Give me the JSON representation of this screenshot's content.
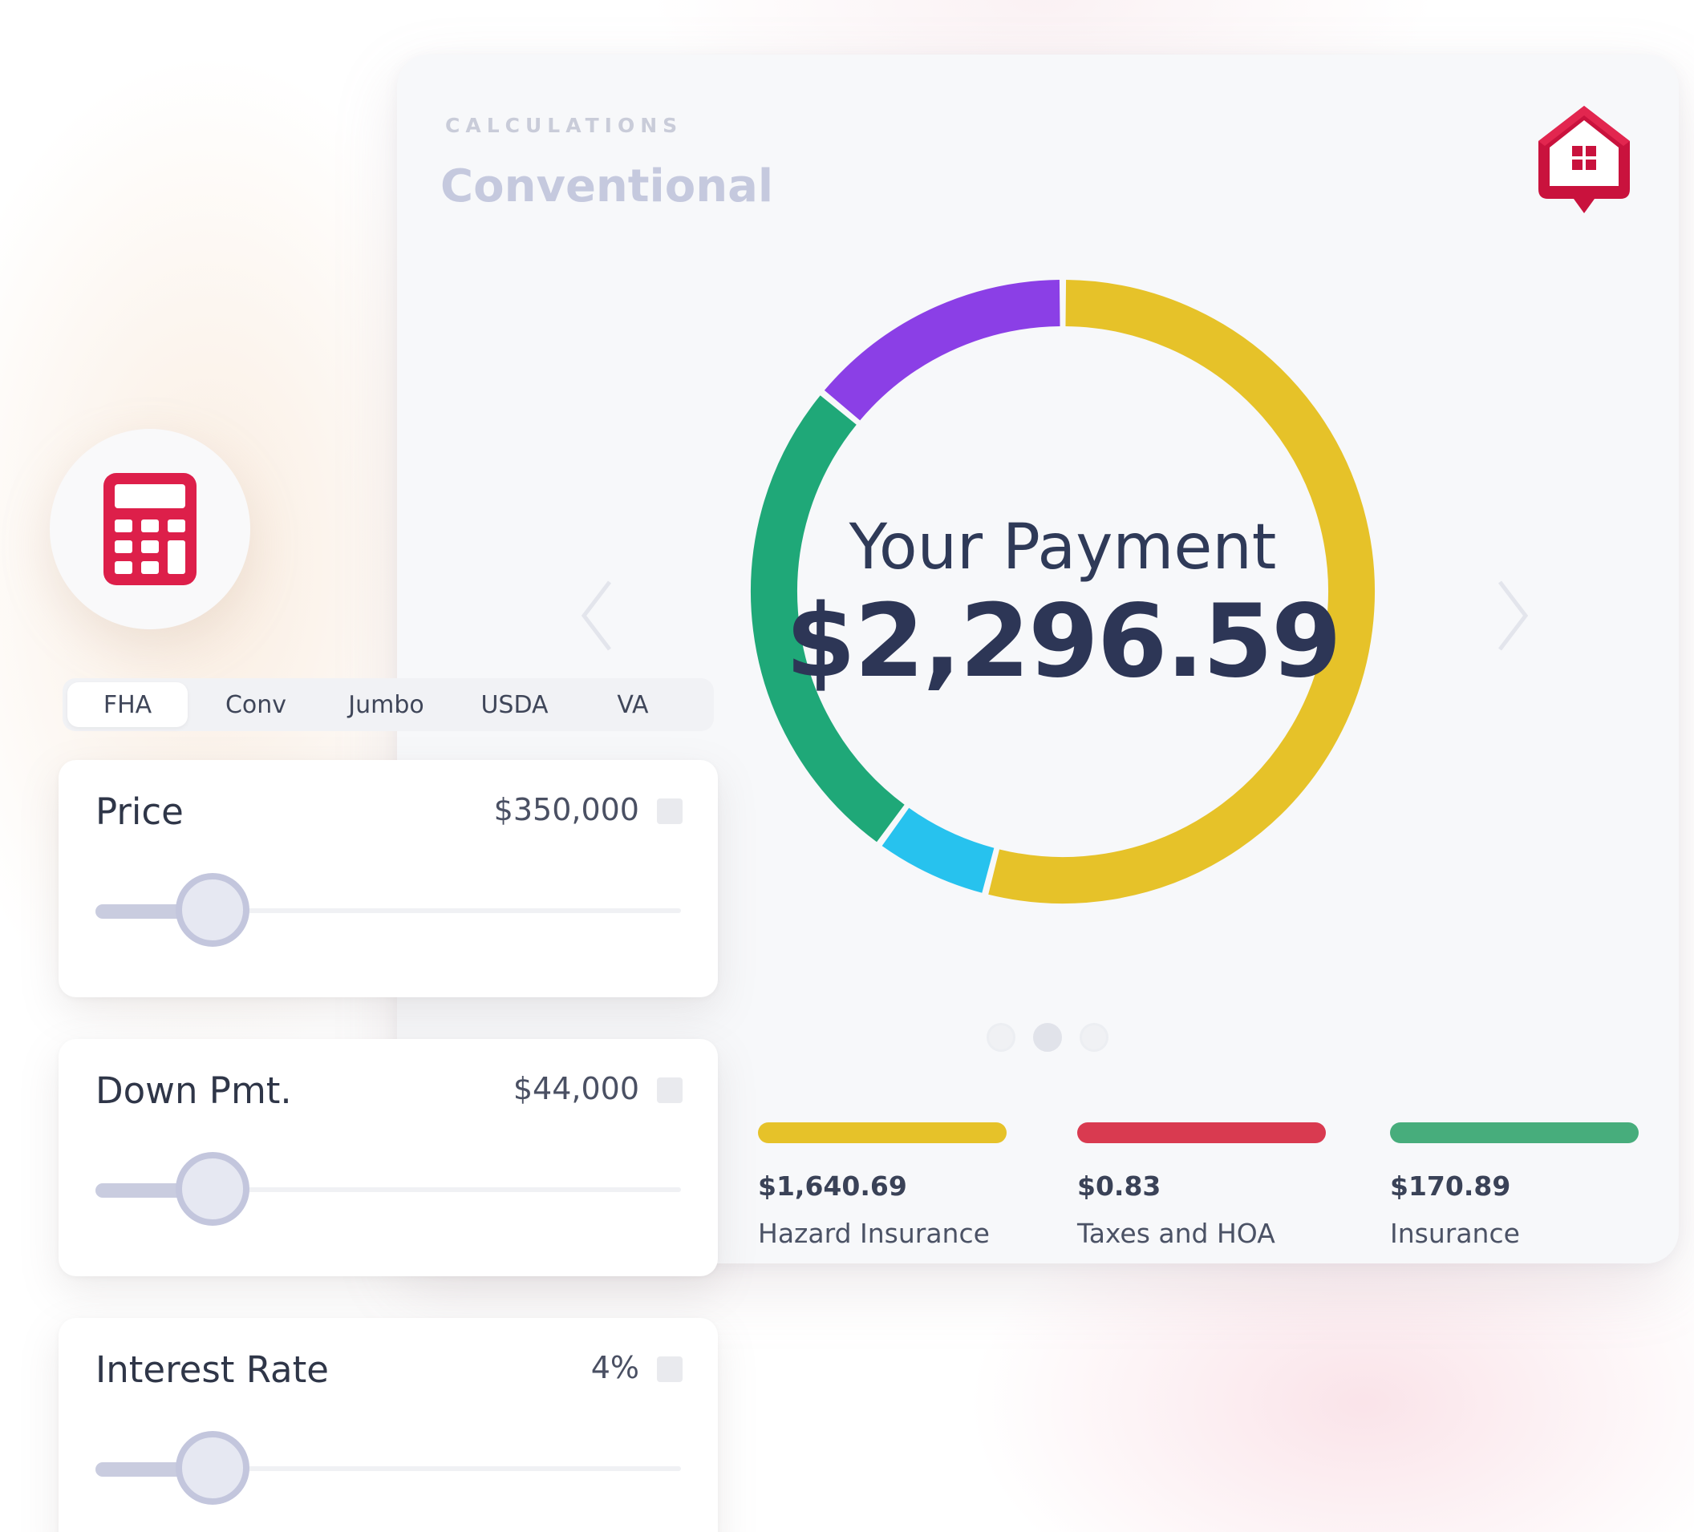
{
  "header": {
    "section_label": "CALCULATIONS",
    "title": "Conventional"
  },
  "brand": {
    "logo_icon": "house-pin-icon"
  },
  "payment": {
    "label": "Your Payment",
    "amount": "$2,296.59"
  },
  "colors": {
    "purple": "#8b3fe6",
    "yellow": "#e6c229",
    "green": "#1fa878",
    "cyan": "#27c2ee",
    "red": "#d93a50",
    "legend_green": "#47ad7c"
  },
  "chart_data": {
    "type": "pie",
    "variant": "donut",
    "start_angle_deg": 0,
    "segments": [
      {
        "color": "#e6c229",
        "fraction": 0.54
      },
      {
        "color": "#27c2ee",
        "fraction": 0.06
      },
      {
        "color": "#1fa878",
        "fraction": 0.26
      },
      {
        "color": "#8b3fe6",
        "fraction": 0.14
      }
    ]
  },
  "carousel": {
    "active_index": 1,
    "count": 3
  },
  "legend": [
    {
      "value": "$1,640.69",
      "label": "Hazard Insurance",
      "color": "#e6c229"
    },
    {
      "value": "$0.83",
      "label": "Taxes and HOA",
      "color": "#d93a50"
    },
    {
      "value": "$170.89",
      "label": "Insurance",
      "color": "#47ad7c"
    }
  ],
  "calculator_badge": {
    "icon": "calculator-icon"
  },
  "tabs": [
    {
      "label": "FHA",
      "active": true
    },
    {
      "label": "Conv",
      "active": false
    },
    {
      "label": "Jumbo",
      "active": false
    },
    {
      "label": "USDA",
      "active": false
    },
    {
      "label": "VA",
      "active": false
    }
  ],
  "sliders": [
    {
      "label": "Price",
      "value": "$350,000",
      "position": 0.2
    },
    {
      "label": "Down Pmt.",
      "value": "$44,000",
      "position": 0.2
    },
    {
      "label": "Interest Rate",
      "value": "4%",
      "position": 0.2
    }
  ]
}
